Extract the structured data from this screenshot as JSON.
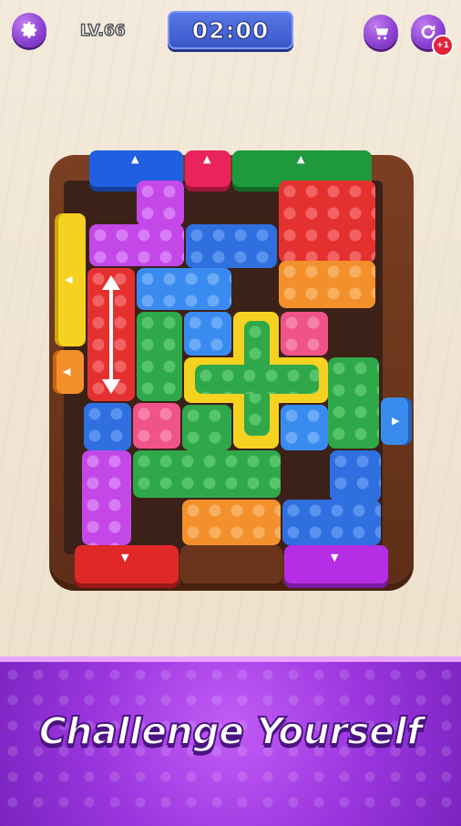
{
  "hud": {
    "level_label": "LV.66",
    "timer": "02:00",
    "refresh_badge": "+1"
  },
  "icons": {
    "settings": "gear-icon",
    "shop": "cart-icon",
    "refresh": "refresh-icon"
  },
  "banner": {
    "tagline": "Challenge Yourself"
  },
  "colors": {
    "purple_button": "#8a3fd0",
    "timer_blue": "#3a55c8",
    "banner_purple": "#9a35de",
    "brick_red": "#e53030",
    "brick_blue": "#2f6fe0",
    "brick_green": "#2fa84a",
    "brick_yellow": "#f5d21f",
    "brick_orange": "#f4902c",
    "brick_magenta": "#c448e8",
    "brick_pink": "#f0538a",
    "wood": "#6e3a1f"
  }
}
